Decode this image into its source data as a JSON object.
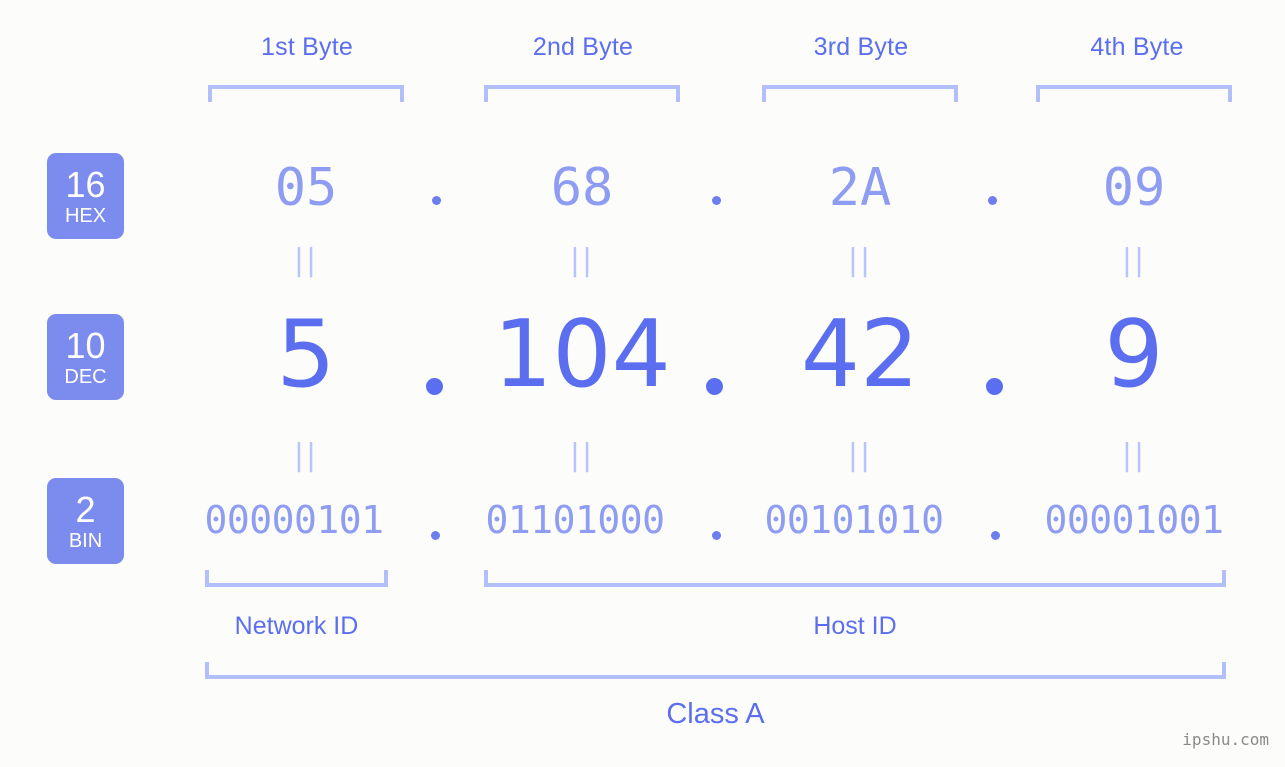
{
  "page": {
    "background_color": "#fcfdfa",
    "accent_color": "#5b6ef0",
    "accent_light_color": "#8e9cf2",
    "bracket_color": "#b3bffa",
    "badge_color": "#7b8cee",
    "watermark": "ipshu.com"
  },
  "byte_headers": [
    {
      "label": "1st Byte"
    },
    {
      "label": "2nd Byte"
    },
    {
      "label": "3rd Byte"
    },
    {
      "label": "4th Byte"
    }
  ],
  "radix_badges": [
    {
      "number": "16",
      "name": "HEX"
    },
    {
      "number": "10",
      "name": "DEC"
    },
    {
      "number": "2",
      "name": "BIN"
    }
  ],
  "rows": {
    "hex": {
      "radix": "16",
      "name": "HEX",
      "values": [
        "05",
        "68",
        "2A",
        "09"
      ],
      "separator": "."
    },
    "dec": {
      "radix": "10",
      "name": "DEC",
      "values": [
        "5",
        "104",
        "42",
        "9"
      ],
      "separator": "."
    },
    "bin": {
      "radix": "2",
      "name": "BIN",
      "values": [
        "00000101",
        "01101000",
        "00101010",
        "00001001"
      ],
      "separator": "."
    }
  },
  "equality_marks": {
    "symbol": "||",
    "rows": 2,
    "columns": 4
  },
  "sections": [
    {
      "label": "Network ID"
    },
    {
      "label": "Host ID"
    }
  ],
  "class_label": "Class A"
}
